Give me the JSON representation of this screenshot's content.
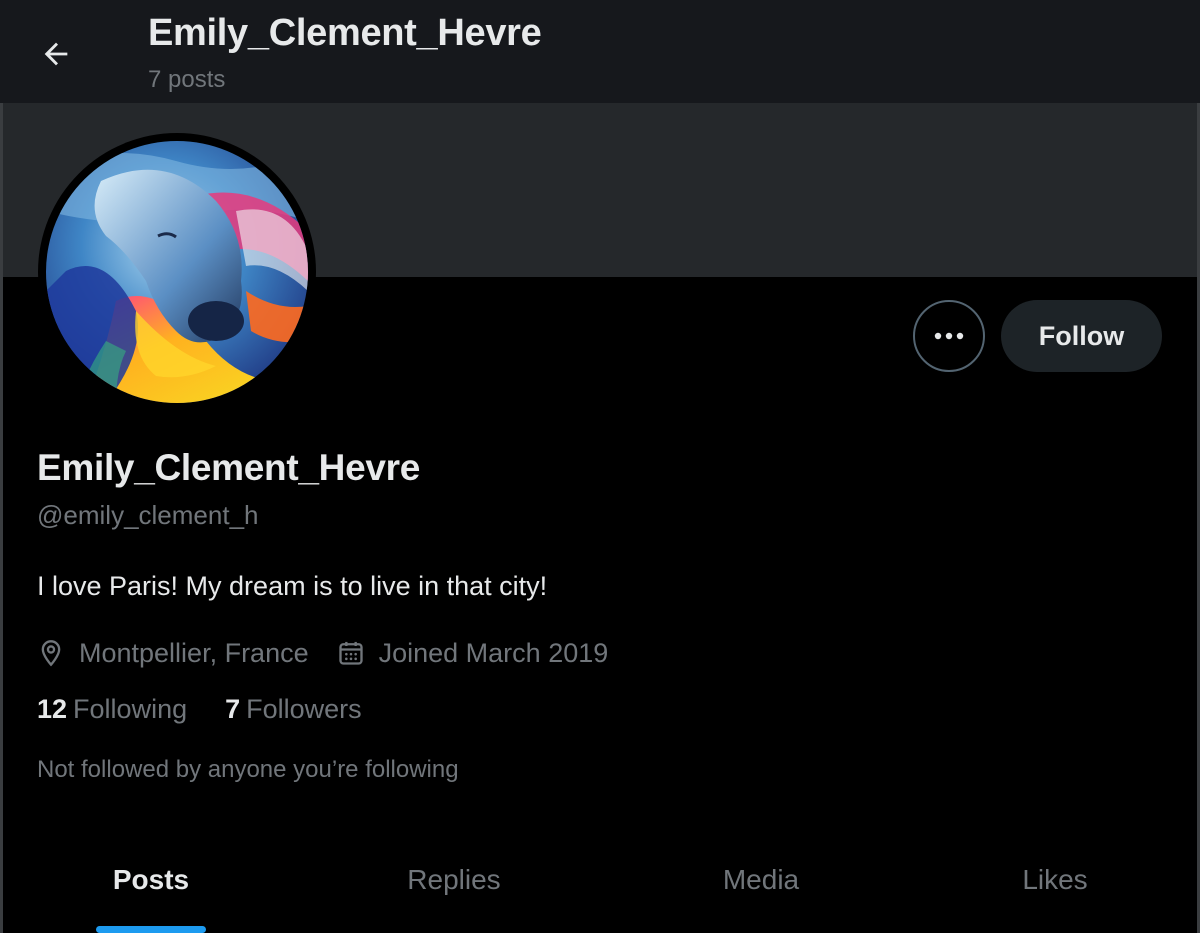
{
  "header": {
    "title": "Emily_Clement_Hevre",
    "posts_count": "7 posts"
  },
  "profile": {
    "display_name": "Emily_Clement_Hevre",
    "handle": "@emily_clement_h",
    "bio": "I love Paris! My dream is to live in that city!",
    "location": "Montpellier, France",
    "joined": "Joined March 2019",
    "following_count": "12",
    "following_label": "Following",
    "followers_count": "7",
    "followers_label": "Followers",
    "mutuals_note": "Not followed by anyone you’re following"
  },
  "actions": {
    "follow_label": "Follow",
    "more_icon": "more-horizontal-icon"
  },
  "tabs": [
    {
      "label": "Posts",
      "active": true
    },
    {
      "label": "Replies",
      "active": false
    },
    {
      "label": "Media",
      "active": false
    },
    {
      "label": "Likes",
      "active": false
    }
  ],
  "colors": {
    "background": "#000000",
    "topbar": "#16181c",
    "banner": "#25282b",
    "accent": "#1d9bf0",
    "primary_text": "#e7e9ea",
    "secondary_text": "#71767b"
  },
  "icons": {
    "back": "arrow-left-icon",
    "location": "location-pin-icon",
    "calendar": "calendar-icon"
  }
}
